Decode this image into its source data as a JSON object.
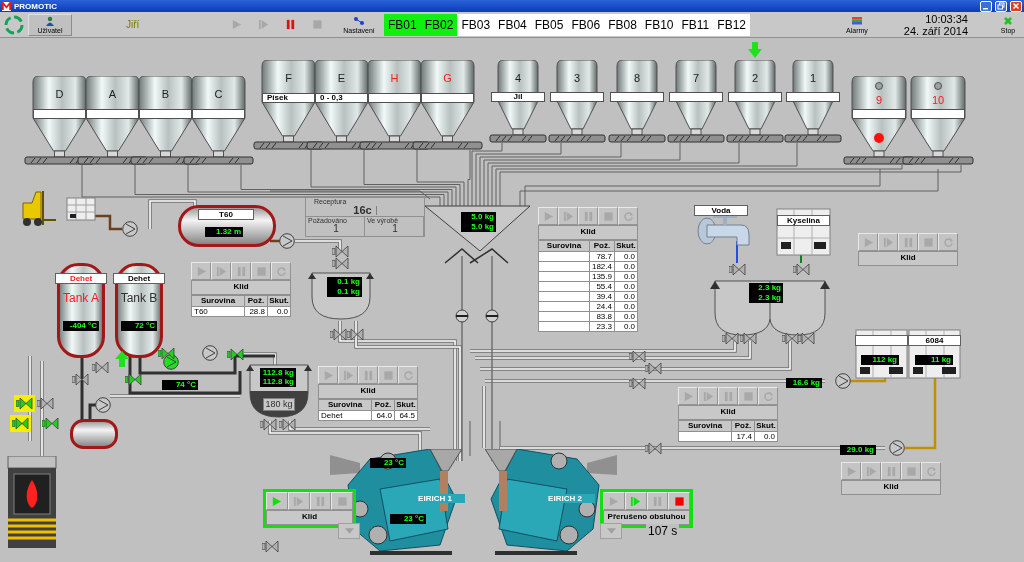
{
  "window": {
    "title": "PROMOTIC"
  },
  "toolbar": {
    "user_button": "Uživatel",
    "user_name": "Jiří",
    "settings_button": "Nastavení",
    "alarms_button": "Alarmy",
    "time": "10:03:34",
    "date": "24. září 2014",
    "stop_button": "Stop",
    "transport": [
      {
        "kind": "play",
        "on": false
      },
      {
        "kind": "step",
        "on": false
      },
      {
        "kind": "pause",
        "on": true
      },
      {
        "kind": "stop",
        "on": false
      }
    ]
  },
  "tabs": [
    {
      "label": "FB01",
      "selected": true
    },
    {
      "label": "FB02",
      "selected": true
    },
    {
      "label": "FB03",
      "selected": false
    },
    {
      "label": "FB04",
      "selected": false
    },
    {
      "label": "FB05",
      "selected": false
    },
    {
      "label": "FB06",
      "selected": false
    },
    {
      "label": "FB08",
      "selected": false
    },
    {
      "label": "FB10",
      "selected": false
    },
    {
      "label": "FB11",
      "selected": false
    },
    {
      "label": "FB12",
      "selected": false
    }
  ],
  "silos": [
    {
      "label": "D",
      "kind": "large",
      "highlighted": false,
      "filling": false,
      "alarm_lamp": false
    },
    {
      "label": "A",
      "kind": "large",
      "highlighted": false,
      "filling": false,
      "alarm_lamp": false
    },
    {
      "label": "B",
      "kind": "large",
      "highlighted": false,
      "filling": false,
      "alarm_lamp": false
    },
    {
      "label": "C",
      "kind": "large",
      "highlighted": false,
      "filling": false,
      "alarm_lamp": false
    },
    {
      "label": "F",
      "tag": "Písek",
      "kind": "tall",
      "highlighted": false,
      "filling": false,
      "alarm_lamp": false
    },
    {
      "label": "E",
      "tag": "0 - 0,3",
      "kind": "tall",
      "highlighted": false,
      "filling": false,
      "alarm_lamp": false
    },
    {
      "label": "H",
      "kind": "tall",
      "highlighted": true,
      "filling": false,
      "alarm_lamp": false
    },
    {
      "label": "G",
      "kind": "tall",
      "highlighted": true,
      "filling": false,
      "alarm_lamp": false
    },
    {
      "label": "4",
      "tag": "Jíl",
      "kind": "small",
      "highlighted": false,
      "filling": false,
      "alarm_lamp": false
    },
    {
      "label": "3",
      "kind": "small",
      "highlighted": false,
      "filling": false,
      "alarm_lamp": false
    },
    {
      "label": "8",
      "kind": "small",
      "highlighted": false,
      "filling": false,
      "alarm_lamp": false
    },
    {
      "label": "7",
      "kind": "small",
      "highlighted": false,
      "filling": false,
      "alarm_lamp": false
    },
    {
      "label": "2",
      "kind": "small",
      "highlighted": false,
      "filling": true,
      "alarm_lamp": false
    },
    {
      "label": "1",
      "kind": "small",
      "highlighted": false,
      "filling": false,
      "alarm_lamp": false
    },
    {
      "label": "9",
      "kind": "bin",
      "highlighted": true,
      "filling": false,
      "alarm_lamp": true
    },
    {
      "label": "10",
      "kind": "bin",
      "highlighted": true,
      "filling": false,
      "alarm_lamp": false
    }
  ],
  "recipe": {
    "title": "Receptura",
    "name": "16c",
    "required_label": "Požadováno",
    "required": "1",
    "produced_label": "Ve výrobě",
    "produced": "1"
  },
  "vessels": {
    "t60_plate": "T60",
    "water_plate": "Voda",
    "acid_plate": "Kyselina"
  },
  "tanks": [
    {
      "plate": "Dehet",
      "name": "Tank A",
      "alarm": true,
      "filling": false
    },
    {
      "plate": "Dehet",
      "name": "Tank B",
      "alarm": false,
      "filling": true
    }
  ],
  "containers": [
    {
      "kind": "unlabeled"
    },
    {
      "kind": "labeled",
      "plate": "6084"
    }
  ],
  "readouts": [
    {
      "text": "1.32 m",
      "kind": "lcd"
    },
    {
      "text": "5.0 kg",
      "kind": "lcd"
    },
    {
      "text": "5.0 kg",
      "kind": "lcd"
    },
    {
      "text": "0.1 kg",
      "kind": "lcd"
    },
    {
      "text": "0.1 kg",
      "kind": "lcd"
    },
    {
      "text": "-404 °C",
      "kind": "lcd"
    },
    {
      "text": "72 °C",
      "kind": "lcd"
    },
    {
      "text": "74 °C",
      "kind": "lcd"
    },
    {
      "text": "112.8 kg",
      "kind": "lcd"
    },
    {
      "text": "112.8 kg",
      "kind": "lcd"
    },
    {
      "text": "180 kg",
      "kind": "plate"
    },
    {
      "text": "2.3 kg",
      "kind": "lcd"
    },
    {
      "text": "2.3 kg",
      "kind": "lcd"
    },
    {
      "text": "112 kg",
      "kind": "lcd"
    },
    {
      "text": "11 kg",
      "kind": "lcd"
    },
    {
      "text": "16.6 kg",
      "kind": "lcd"
    },
    {
      "text": "29.0 kg",
      "kind": "lcd"
    },
    {
      "text": "23 °C",
      "kind": "lcd"
    },
    {
      "text": "23 °C",
      "kind": "lcd"
    }
  ],
  "pumps": [
    {
      "running": false
    },
    {
      "running": false
    },
    {
      "running": false
    },
    {
      "running": true
    },
    {
      "running": false
    },
    {
      "running": false
    },
    {
      "running": false
    }
  ],
  "valves": [
    {
      "open": false,
      "highlighted": false
    },
    {
      "open": false,
      "highlighted": false
    },
    {
      "open": false,
      "highlighted": false
    },
    {
      "open": false,
      "highlighted": false
    },
    {
      "open": true,
      "highlighted": false
    },
    {
      "open": true,
      "highlighted": false
    },
    {
      "open": true,
      "highlighted": false
    },
    {
      "open": true,
      "highlighted": true
    },
    {
      "open": false,
      "highlighted": false
    },
    {
      "open": true,
      "highlighted": true
    },
    {
      "open": true,
      "highlighted": false
    },
    {
      "open": false,
      "highlighted": false
    },
    {
      "open": false,
      "highlighted": false
    },
    {
      "open": false,
      "highlighted": false
    },
    {
      "open": false,
      "highlighted": false
    },
    {
      "open": false,
      "highlighted": false
    },
    {
      "open": false,
      "highlighted": false
    },
    {
      "open": false,
      "highlighted": false
    },
    {
      "open": false,
      "highlighted": false
    },
    {
      "open": false,
      "highlighted": false
    },
    {
      "open": false,
      "highlighted": false
    },
    {
      "open": false,
      "highlighted": false
    },
    {
      "open": false,
      "highlighted": false
    },
    {
      "open": false,
      "highlighted": false
    },
    {
      "open": false,
      "highlighted": false
    },
    {
      "open": false,
      "highlighted": false
    }
  ],
  "panels": [
    {
      "status": "Klid",
      "active": false,
      "buttons": [
        {
          "kind": "play",
          "on": false
        },
        {
          "kind": "step",
          "on": false
        },
        {
          "kind": "pause",
          "on": false
        },
        {
          "kind": "stop",
          "on": false
        },
        {
          "kind": "reset",
          "on": false
        }
      ],
      "table": {
        "columns": [
          "Surovina",
          "Pož.",
          "Skut."
        ],
        "rows": [
          {
            "material": "T60",
            "required": "28.8",
            "actual": "0.0"
          }
        ]
      }
    },
    {
      "status": "Klid",
      "active": false,
      "buttons": [
        {
          "kind": "play",
          "on": false
        },
        {
          "kind": "step",
          "on": false
        },
        {
          "kind": "pause",
          "on": false
        },
        {
          "kind": "stop",
          "on": false
        },
        {
          "kind": "reset",
          "on": false
        }
      ],
      "table": {
        "columns": [
          "Surovina",
          "Pož.",
          "Skut."
        ],
        "rows": [
          {
            "material": "Dehet",
            "required": "64.0",
            "actual": "64.5"
          }
        ]
      }
    },
    {
      "status": "Klid",
      "active": false,
      "buttons": [
        {
          "kind": "play",
          "on": false
        },
        {
          "kind": "step",
          "on": false
        },
        {
          "kind": "pause",
          "on": false
        },
        {
          "kind": "stop",
          "on": false
        },
        {
          "kind": "reset",
          "on": false
        }
      ],
      "table": {
        "columns": [
          "Surovina",
          "Pož.",
          "Skut."
        ],
        "rows": [
          {
            "required": "78.7",
            "actual": "0.0"
          },
          {
            "required": "182.4",
            "actual": "0.0"
          },
          {
            "required": "135.9",
            "actual": "0.0"
          },
          {
            "required": "55.4",
            "actual": "0.0"
          },
          {
            "required": "39.4",
            "actual": "0.0"
          },
          {
            "required": "24.4",
            "actual": "0.0"
          },
          {
            "required": "83.8",
            "actual": "0.0"
          },
          {
            "required": "23.3",
            "actual": "0.0"
          }
        ]
      }
    },
    {
      "status": "Klid",
      "active": false,
      "buttons": [
        {
          "kind": "play",
          "on": false
        },
        {
          "kind": "step",
          "on": false
        },
        {
          "kind": "pause",
          "on": false
        },
        {
          "kind": "stop",
          "on": false
        },
        {
          "kind": "reset",
          "on": false
        }
      ]
    },
    {
      "status": "Klid",
      "active": false,
      "buttons": [
        {
          "kind": "play",
          "on": false
        },
        {
          "kind": "step",
          "on": false
        },
        {
          "kind": "pause",
          "on": false
        },
        {
          "kind": "stop",
          "on": false
        },
        {
          "kind": "reset",
          "on": false
        }
      ],
      "table": {
        "columns": [
          "Surovina",
          "Pož.",
          "Skut."
        ],
        "rows": [
          {
            "required": "17.4",
            "actual": "0.0"
          }
        ]
      }
    },
    {
      "status": "Klid",
      "active": false,
      "buttons": [
        {
          "kind": "play",
          "on": false
        },
        {
          "kind": "step",
          "on": false
        },
        {
          "kind": "pause",
          "on": false
        },
        {
          "kind": "stop",
          "on": false
        },
        {
          "kind": "reset",
          "on": false
        }
      ]
    },
    {
      "status": "Klid",
      "active": true,
      "buttons": [
        {
          "kind": "play",
          "on": true
        },
        {
          "kind": "step",
          "on": false
        },
        {
          "kind": "pause",
          "on": false
        },
        {
          "kind": "stop",
          "on": false
        }
      ]
    },
    {
      "status": "Přerušeno obsluhou",
      "active": true,
      "buttons": [
        {
          "kind": "play",
          "on": false
        },
        {
          "kind": "step",
          "on": true
        },
        {
          "kind": "pause",
          "on": false
        },
        {
          "kind": "stop",
          "on": true
        }
      ]
    }
  ],
  "mixers": [
    {
      "name": "EIRICH 1"
    },
    {
      "name": "EIRICH 2"
    }
  ],
  "timer": "107 s"
}
